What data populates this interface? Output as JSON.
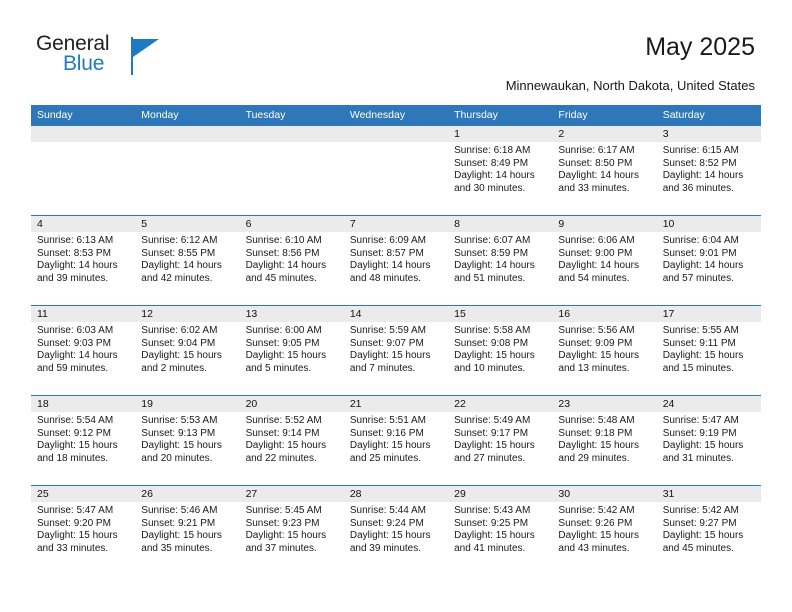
{
  "brand": {
    "name_part1": "General",
    "name_part2": "Blue",
    "accent_color": "#1f7bc1"
  },
  "header": {
    "title": "May 2025",
    "location": "Minnewaukan, North Dakota, United States"
  },
  "theme": {
    "header_blue": "#2e77b8",
    "daynum_band": "#ebebeb"
  },
  "weekdays": [
    "Sunday",
    "Monday",
    "Tuesday",
    "Wednesday",
    "Thursday",
    "Friday",
    "Saturday"
  ],
  "weeks": [
    {
      "days": [
        {
          "num": "",
          "sunrise": "",
          "sunset": "",
          "daylight": ""
        },
        {
          "num": "",
          "sunrise": "",
          "sunset": "",
          "daylight": ""
        },
        {
          "num": "",
          "sunrise": "",
          "sunset": "",
          "daylight": ""
        },
        {
          "num": "",
          "sunrise": "",
          "sunset": "",
          "daylight": ""
        },
        {
          "num": "1",
          "sunrise": "Sunrise: 6:18 AM",
          "sunset": "Sunset: 8:49 PM",
          "daylight": "Daylight: 14 hours and 30 minutes."
        },
        {
          "num": "2",
          "sunrise": "Sunrise: 6:17 AM",
          "sunset": "Sunset: 8:50 PM",
          "daylight": "Daylight: 14 hours and 33 minutes."
        },
        {
          "num": "3",
          "sunrise": "Sunrise: 6:15 AM",
          "sunset": "Sunset: 8:52 PM",
          "daylight": "Daylight: 14 hours and 36 minutes."
        }
      ]
    },
    {
      "days": [
        {
          "num": "4",
          "sunrise": "Sunrise: 6:13 AM",
          "sunset": "Sunset: 8:53 PM",
          "daylight": "Daylight: 14 hours and 39 minutes."
        },
        {
          "num": "5",
          "sunrise": "Sunrise: 6:12 AM",
          "sunset": "Sunset: 8:55 PM",
          "daylight": "Daylight: 14 hours and 42 minutes."
        },
        {
          "num": "6",
          "sunrise": "Sunrise: 6:10 AM",
          "sunset": "Sunset: 8:56 PM",
          "daylight": "Daylight: 14 hours and 45 minutes."
        },
        {
          "num": "7",
          "sunrise": "Sunrise: 6:09 AM",
          "sunset": "Sunset: 8:57 PM",
          "daylight": "Daylight: 14 hours and 48 minutes."
        },
        {
          "num": "8",
          "sunrise": "Sunrise: 6:07 AM",
          "sunset": "Sunset: 8:59 PM",
          "daylight": "Daylight: 14 hours and 51 minutes."
        },
        {
          "num": "9",
          "sunrise": "Sunrise: 6:06 AM",
          "sunset": "Sunset: 9:00 PM",
          "daylight": "Daylight: 14 hours and 54 minutes."
        },
        {
          "num": "10",
          "sunrise": "Sunrise: 6:04 AM",
          "sunset": "Sunset: 9:01 PM",
          "daylight": "Daylight: 14 hours and 57 minutes."
        }
      ]
    },
    {
      "days": [
        {
          "num": "11",
          "sunrise": "Sunrise: 6:03 AM",
          "sunset": "Sunset: 9:03 PM",
          "daylight": "Daylight: 14 hours and 59 minutes."
        },
        {
          "num": "12",
          "sunrise": "Sunrise: 6:02 AM",
          "sunset": "Sunset: 9:04 PM",
          "daylight": "Daylight: 15 hours and 2 minutes."
        },
        {
          "num": "13",
          "sunrise": "Sunrise: 6:00 AM",
          "sunset": "Sunset: 9:05 PM",
          "daylight": "Daylight: 15 hours and 5 minutes."
        },
        {
          "num": "14",
          "sunrise": "Sunrise: 5:59 AM",
          "sunset": "Sunset: 9:07 PM",
          "daylight": "Daylight: 15 hours and 7 minutes."
        },
        {
          "num": "15",
          "sunrise": "Sunrise: 5:58 AM",
          "sunset": "Sunset: 9:08 PM",
          "daylight": "Daylight: 15 hours and 10 minutes."
        },
        {
          "num": "16",
          "sunrise": "Sunrise: 5:56 AM",
          "sunset": "Sunset: 9:09 PM",
          "daylight": "Daylight: 15 hours and 13 minutes."
        },
        {
          "num": "17",
          "sunrise": "Sunrise: 5:55 AM",
          "sunset": "Sunset: 9:11 PM",
          "daylight": "Daylight: 15 hours and 15 minutes."
        }
      ]
    },
    {
      "days": [
        {
          "num": "18",
          "sunrise": "Sunrise: 5:54 AM",
          "sunset": "Sunset: 9:12 PM",
          "daylight": "Daylight: 15 hours and 18 minutes."
        },
        {
          "num": "19",
          "sunrise": "Sunrise: 5:53 AM",
          "sunset": "Sunset: 9:13 PM",
          "daylight": "Daylight: 15 hours and 20 minutes."
        },
        {
          "num": "20",
          "sunrise": "Sunrise: 5:52 AM",
          "sunset": "Sunset: 9:14 PM",
          "daylight": "Daylight: 15 hours and 22 minutes."
        },
        {
          "num": "21",
          "sunrise": "Sunrise: 5:51 AM",
          "sunset": "Sunset: 9:16 PM",
          "daylight": "Daylight: 15 hours and 25 minutes."
        },
        {
          "num": "22",
          "sunrise": "Sunrise: 5:49 AM",
          "sunset": "Sunset: 9:17 PM",
          "daylight": "Daylight: 15 hours and 27 minutes."
        },
        {
          "num": "23",
          "sunrise": "Sunrise: 5:48 AM",
          "sunset": "Sunset: 9:18 PM",
          "daylight": "Daylight: 15 hours and 29 minutes."
        },
        {
          "num": "24",
          "sunrise": "Sunrise: 5:47 AM",
          "sunset": "Sunset: 9:19 PM",
          "daylight": "Daylight: 15 hours and 31 minutes."
        }
      ]
    },
    {
      "days": [
        {
          "num": "25",
          "sunrise": "Sunrise: 5:47 AM",
          "sunset": "Sunset: 9:20 PM",
          "daylight": "Daylight: 15 hours and 33 minutes."
        },
        {
          "num": "26",
          "sunrise": "Sunrise: 5:46 AM",
          "sunset": "Sunset: 9:21 PM",
          "daylight": "Daylight: 15 hours and 35 minutes."
        },
        {
          "num": "27",
          "sunrise": "Sunrise: 5:45 AM",
          "sunset": "Sunset: 9:23 PM",
          "daylight": "Daylight: 15 hours and 37 minutes."
        },
        {
          "num": "28",
          "sunrise": "Sunrise: 5:44 AM",
          "sunset": "Sunset: 9:24 PM",
          "daylight": "Daylight: 15 hours and 39 minutes."
        },
        {
          "num": "29",
          "sunrise": "Sunrise: 5:43 AM",
          "sunset": "Sunset: 9:25 PM",
          "daylight": "Daylight: 15 hours and 41 minutes."
        },
        {
          "num": "30",
          "sunrise": "Sunrise: 5:42 AM",
          "sunset": "Sunset: 9:26 PM",
          "daylight": "Daylight: 15 hours and 43 minutes."
        },
        {
          "num": "31",
          "sunrise": "Sunrise: 5:42 AM",
          "sunset": "Sunset: 9:27 PM",
          "daylight": "Daylight: 15 hours and 45 minutes."
        }
      ]
    }
  ]
}
